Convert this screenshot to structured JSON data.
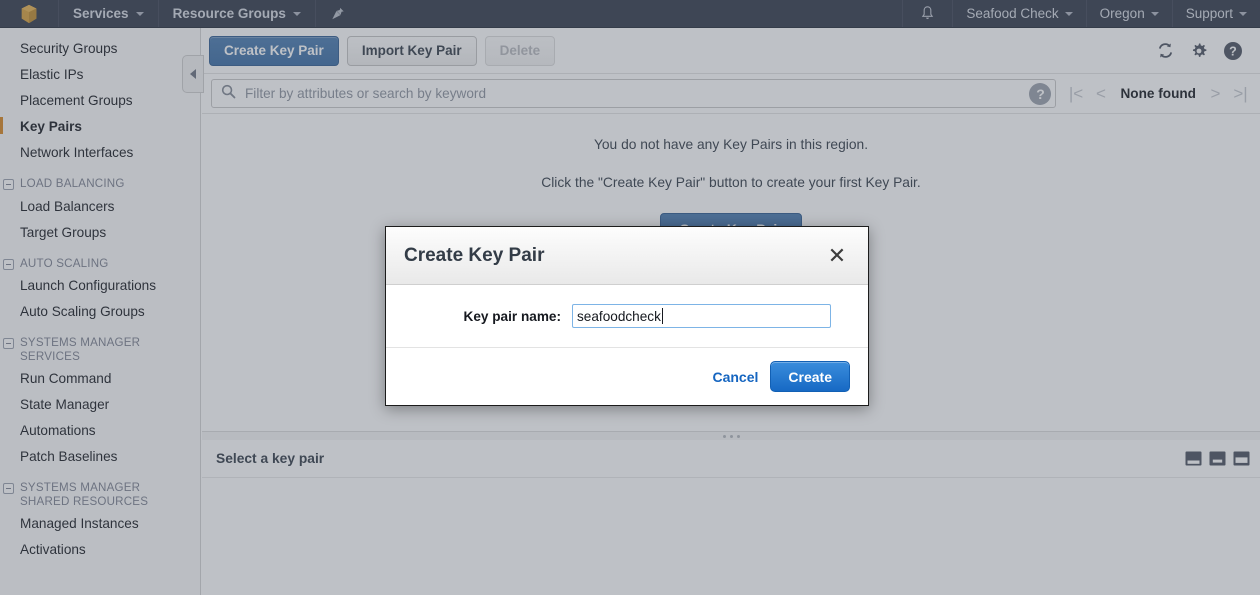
{
  "topnav": {
    "logo_icon": "aws-cube-icon",
    "services_label": "Services",
    "resource_groups_label": "Resource Groups",
    "pin_icon": "pin-icon",
    "bell_icon": "bell-icon",
    "account_label": "Seafood Check",
    "region_label": "Oregon",
    "support_label": "Support",
    "background_color": "#31394a",
    "text_color": "#d6dae2"
  },
  "sidebar": {
    "collapse_icon": "chevron-left-icon",
    "items": [
      {
        "label": "Security Groups",
        "type": "link",
        "active": false
      },
      {
        "label": "Elastic IPs",
        "type": "link",
        "active": false
      },
      {
        "label": "Placement Groups",
        "type": "link",
        "active": false
      },
      {
        "label": "Key Pairs",
        "type": "link",
        "active": true
      },
      {
        "label": "Network Interfaces",
        "type": "link",
        "active": false
      },
      {
        "label": "LOAD BALANCING",
        "type": "group"
      },
      {
        "label": "Load Balancers",
        "type": "link",
        "active": false
      },
      {
        "label": "Target Groups",
        "type": "link",
        "active": false
      },
      {
        "label": "AUTO SCALING",
        "type": "group"
      },
      {
        "label": "Launch Configurations",
        "type": "link",
        "active": false
      },
      {
        "label": "Auto Scaling Groups",
        "type": "link",
        "active": false
      },
      {
        "label": "SYSTEMS MANAGER SERVICES",
        "type": "group"
      },
      {
        "label": "Run Command",
        "type": "link",
        "active": false
      },
      {
        "label": "State Manager",
        "type": "link",
        "active": false
      },
      {
        "label": "Automations",
        "type": "link",
        "active": false
      },
      {
        "label": "Patch Baselines",
        "type": "link",
        "active": false
      },
      {
        "label": "SYSTEMS MANAGER SHARED RESOURCES",
        "type": "group"
      },
      {
        "label": "Managed Instances",
        "type": "link",
        "active": false
      },
      {
        "label": "Activations",
        "type": "link",
        "active": false
      }
    ],
    "active_marker_color": "#d9871f"
  },
  "toolbar": {
    "create_label": "Create Key Pair",
    "import_label": "Import Key Pair",
    "delete_label": "Delete",
    "delete_disabled": true,
    "refresh_icon": "refresh-icon",
    "settings_icon": "gear-icon",
    "help_icon": "help-circle-icon",
    "primary_color": "#3a6da5"
  },
  "filter": {
    "search_icon": "search-icon",
    "placeholder": "Filter by attributes or search by keyword",
    "value": "",
    "help_icon": "help-circle-icon"
  },
  "pagination": {
    "first_icon": "page-first-icon",
    "prev_icon": "chevron-left-icon",
    "label": "None found",
    "next_icon": "chevron-right-icon",
    "last_icon": "page-last-icon"
  },
  "empty_state": {
    "line1": "You do not have any Key Pairs in this region.",
    "line2": "Click the \"Create Key Pair\" button to create your first Key Pair.",
    "cta_label": "Create Key Pair"
  },
  "bottom_panel": {
    "title": "Select a key pair",
    "layout_icons": [
      "layout-bottom-icon",
      "layout-split-icon",
      "layout-right-icon"
    ],
    "resizer_icon": "drag-handle-icon"
  },
  "modal": {
    "title": "Create Key Pair",
    "close_icon": "close-icon",
    "field_label": "Key pair name:",
    "field_value": "seafoodcheck",
    "field_placeholder": "",
    "cancel_label": "Cancel",
    "create_label": "Create",
    "create_color": "#1769c4"
  }
}
